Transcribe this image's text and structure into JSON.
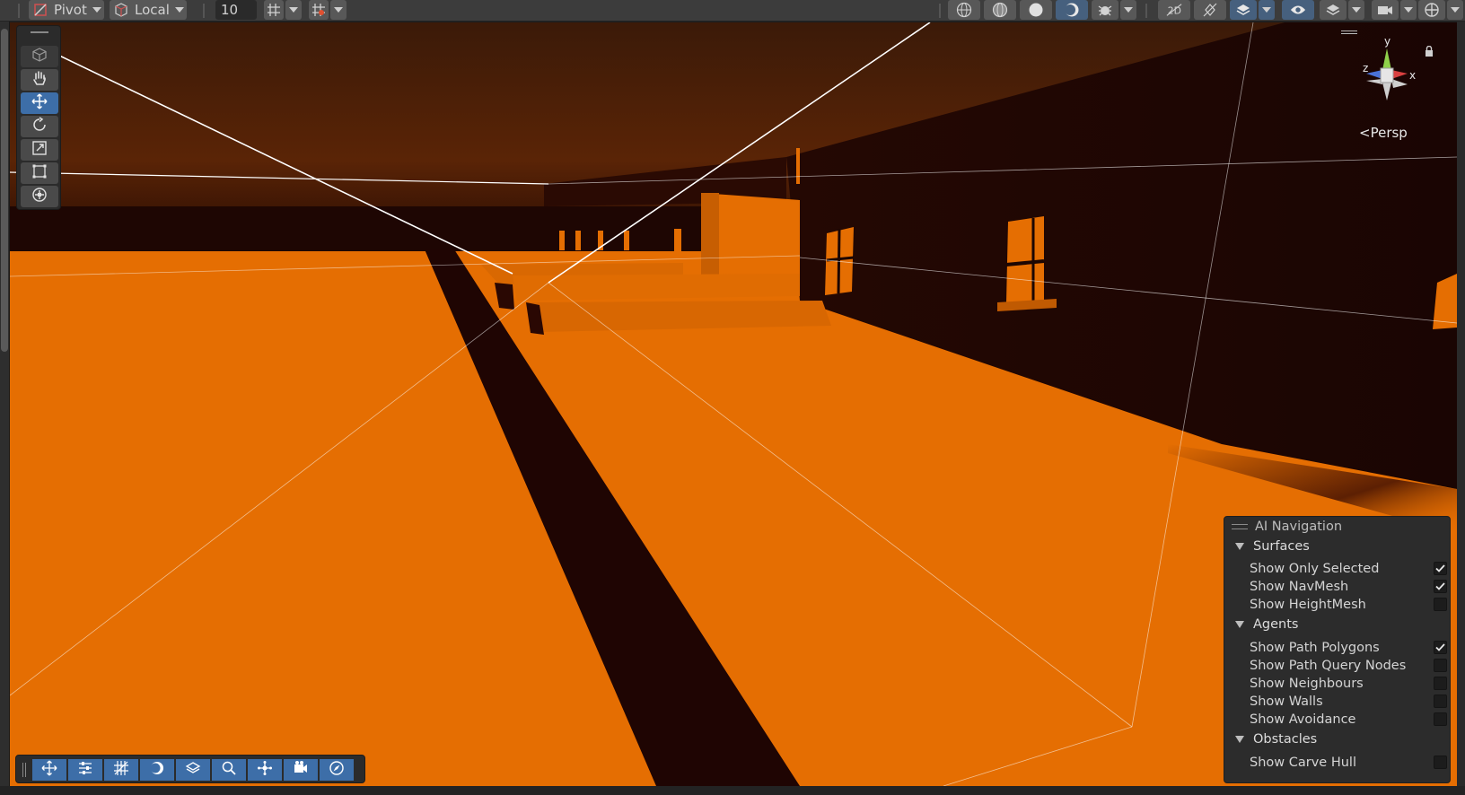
{
  "toolbar": {
    "pivot_label": "Pivot",
    "local_label": "Local",
    "grid_size_value": "10"
  },
  "scene_view": {
    "projection_label": "Persp",
    "gizmo_axes": {
      "x": "x",
      "y": "y",
      "z": "z"
    },
    "colors": {
      "floor": "#e56e02",
      "sky": "#2a0d02",
      "wall": "#1c0603",
      "shadow": "#1f0503",
      "active_tool": "#3d6ea8"
    }
  },
  "tools_overlay": {
    "items": [
      "view-tool-icon",
      "hand-tool-icon",
      "move-tool-icon",
      "rotate-tool-icon",
      "scale-tool-icon",
      "rect-tool-icon",
      "transform-tool-icon"
    ],
    "active": "move-tool-icon"
  },
  "ai_navigation": {
    "title": "AI Navigation",
    "sections": [
      {
        "label": "Surfaces",
        "options": [
          {
            "label": "Show Only Selected",
            "checked": true
          },
          {
            "label": "Show NavMesh",
            "checked": true
          },
          {
            "label": "Show HeightMesh",
            "checked": false
          }
        ]
      },
      {
        "label": "Agents",
        "options": [
          {
            "label": "Show Path Polygons",
            "checked": true
          },
          {
            "label": "Show Path Query Nodes",
            "checked": false
          },
          {
            "label": "Show Neighbours",
            "checked": false
          },
          {
            "label": "Show Walls",
            "checked": false
          },
          {
            "label": "Show Avoidance",
            "checked": false
          }
        ]
      },
      {
        "label": "Obstacles",
        "options": [
          {
            "label": "Show Carve Hull",
            "checked": false
          }
        ]
      }
    ]
  },
  "bottom_tools": [
    "move-icon",
    "settings-sliders-icon",
    "grid-icon",
    "shading-icon",
    "layers-icon",
    "search-icon",
    "snap-icon",
    "camera-icon",
    "navigation-icon"
  ]
}
